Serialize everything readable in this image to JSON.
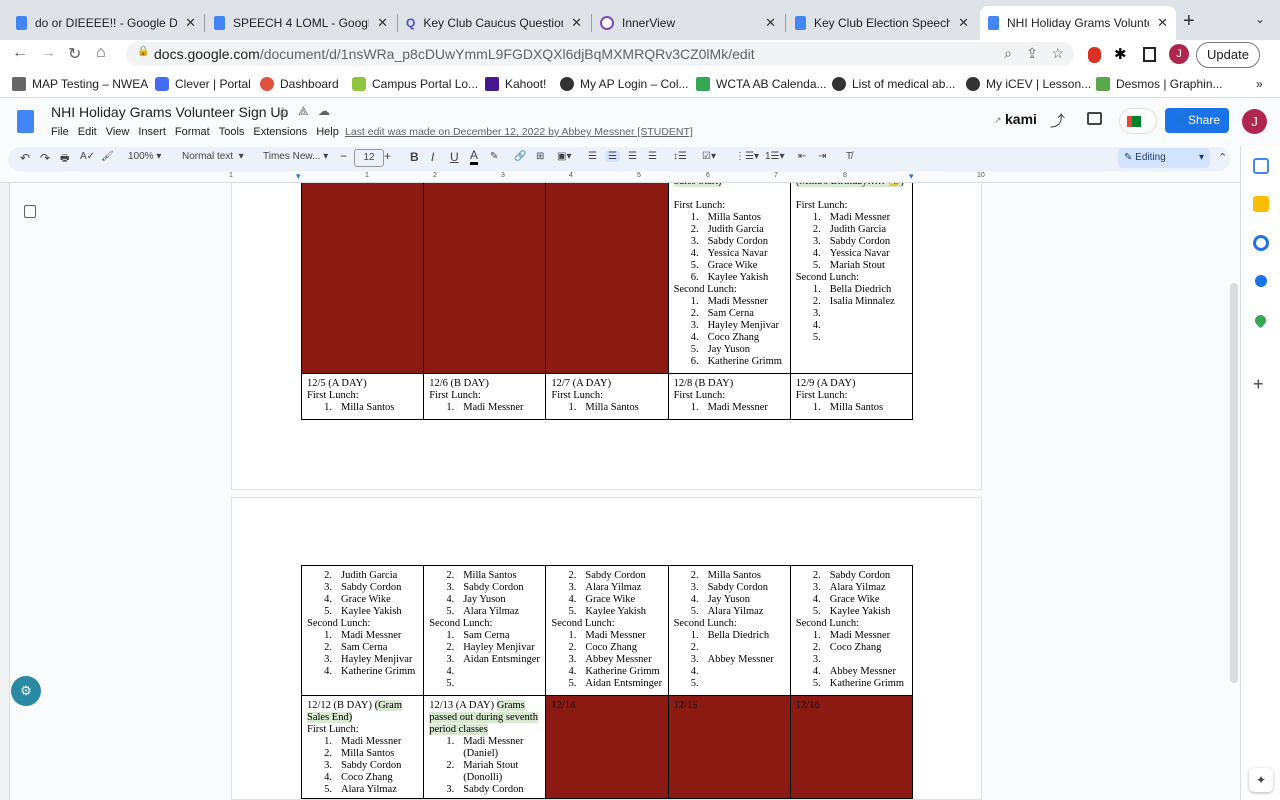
{
  "browser": {
    "tabs": [
      {
        "label": "do or DIEEEE!! - Google Do",
        "icon": "docs-icon"
      },
      {
        "label": "SPEECH 4 LOML - Google D",
        "icon": "docs-icon"
      },
      {
        "label": "Key Club Caucus Questions",
        "icon": "search-icon"
      },
      {
        "label": "InnerView",
        "icon": "innerview-icon"
      },
      {
        "label": "Key Club Election Speech -",
        "icon": "docs-icon"
      },
      {
        "label": "NHI Holiday Grams Voluntee",
        "icon": "docs-icon",
        "active": true
      }
    ],
    "new_tab": "+",
    "url_host": "docs.google.com",
    "url_path": "/document/d/1nsWRa_p8cDUwYmmL9FGDXQXl6djBqMXMRQRv3CZ0lMk/edit",
    "profile_initial": "J",
    "update_label": "Update",
    "bookmarks": [
      "MAP Testing – NWEA",
      "Clever | Portal",
      "Dashboard",
      "Campus Portal Lo...",
      "Kahoot!",
      "My AP Login – Col...",
      "WCTA AB Calenda...",
      "List of medical ab...",
      "My iCEV | Lesson...",
      "Desmos | Graphin..."
    ],
    "more_bookmarks": "»"
  },
  "doc": {
    "title": "NHI Holiday Grams Volunteer Sign Up",
    "menu": [
      "File",
      "Edit",
      "View",
      "Insert",
      "Format",
      "Tools",
      "Extensions",
      "Help"
    ],
    "last_edit": "Last edit was made on December 12, 2022 by Abbey Messner [STUDENT]",
    "kami": "kami",
    "share": "Share",
    "user_initial": "J",
    "toolbar": {
      "zoom": "100%",
      "style": "Normal text",
      "font": "Times New...",
      "size": "12",
      "mode": "Editing"
    },
    "ruler": [
      "1",
      "1",
      "2",
      "3",
      "4",
      "5",
      "6",
      "7",
      "8",
      "10"
    ]
  },
  "colors": {
    "red_cell": "#8b1a12",
    "highlight": "#d9ead3",
    "accent": "#1a73e8"
  },
  "table1": [
    [
      {
        "red": true,
        "lines": []
      },
      {
        "red": true,
        "lines": []
      },
      {
        "red": true,
        "lines": []
      },
      {
        "lines": [
          {
            "t": "Sales Start)",
            "hl": true
          },
          {
            "t": ""
          },
          {
            "t": "First Lunch:"
          },
          {
            "n": "1.",
            "t": "Milla Santos"
          },
          {
            "n": "2.",
            "t": "Judith Garcia"
          },
          {
            "n": "3.",
            "t": "Sabdy Cordon"
          },
          {
            "n": "4.",
            "t": "Yessica Navar"
          },
          {
            "n": "5.",
            "t": "Grace Wike"
          },
          {
            "n": "6.",
            "t": "Kaylee Yakish"
          },
          {
            "t": "Second Lunch:"
          },
          {
            "n": "1.",
            "t": "Madi Messner"
          },
          {
            "n": "2.",
            "t": "Sam Cerna"
          },
          {
            "n": "3.",
            "t": "Hayley Menjivar"
          },
          {
            "n": "4.",
            "t": "Coco Zhang"
          },
          {
            "n": "5.",
            "t": "Jay Yuson"
          },
          {
            "n": "6.",
            "t": "Katherine Grimm"
          }
        ]
      },
      {
        "lines": [
          {
            "t": "(Milla's Birthday!!!!! 🥳)",
            "hl": true
          },
          {
            "t": ""
          },
          {
            "t": "First Lunch:"
          },
          {
            "n": "1.",
            "t": "Madi Messner"
          },
          {
            "n": "2.",
            "t": "Judith Garcia"
          },
          {
            "n": "3.",
            "t": "Sabdy Cordon"
          },
          {
            "n": "4.",
            "t": "Yessica Navar"
          },
          {
            "n": "5.",
            "t": " Mariah Stout"
          },
          {
            "t": "Second Lunch:"
          },
          {
            "n": "1.",
            "t": "Bella Diedrich"
          },
          {
            "n": "2.",
            "t": "Isalia Minnalez"
          },
          {
            "n": "3.",
            "t": ""
          },
          {
            "n": "4.",
            "t": ""
          },
          {
            "n": "5.",
            "t": ""
          }
        ]
      }
    ],
    [
      {
        "lines": [
          {
            "t": "12/5 (A DAY)"
          },
          {
            "t": "First Lunch:"
          },
          {
            "n": "1.",
            "t": "Milla Santos"
          }
        ]
      },
      {
        "lines": [
          {
            "t": "12/6 (B DAY)"
          },
          {
            "t": "First Lunch:"
          },
          {
            "n": "1.",
            "t": "Madi Messner"
          }
        ]
      },
      {
        "lines": [
          {
            "t": "12/7 (A DAY)"
          },
          {
            "t": "First Lunch:"
          },
          {
            "n": "1.",
            "t": "Milla Santos"
          }
        ]
      },
      {
        "lines": [
          {
            "t": "12/8 (B DAY)"
          },
          {
            "t": "First Lunch:"
          },
          {
            "n": "1.",
            "t": "Madi Messner"
          }
        ]
      },
      {
        "lines": [
          {
            "t": "12/9 (A DAY)"
          },
          {
            "t": "First Lunch:"
          },
          {
            "n": "1.",
            "t": "Milla Santos"
          }
        ]
      }
    ]
  ],
  "table2": [
    [
      {
        "lines": [
          {
            "n": "2.",
            "t": "Judith Garcia"
          },
          {
            "n": "3.",
            "t": "Sabdy Cordon"
          },
          {
            "n": "4.",
            "t": " Grace Wike"
          },
          {
            "n": "5.",
            "t": "Kaylee Yakish"
          },
          {
            "t": "Second Lunch:"
          },
          {
            "n": "1.",
            "t": "Madi Messner"
          },
          {
            "n": "2.",
            "t": "Sam Cerna"
          },
          {
            "n": "3.",
            "t": "Hayley Menjivar"
          },
          {
            "n": "4.",
            "t": "Katherine Grimm"
          }
        ]
      },
      {
        "lines": [
          {
            "n": "2.",
            "t": "Milla Santos"
          },
          {
            "n": "3.",
            "t": "Sabdy Cordon"
          },
          {
            "n": "4.",
            "t": "Jay Yuson"
          },
          {
            "n": "5.",
            "t": "Alara Yilmaz"
          },
          {
            "t": "Second Lunch:"
          },
          {
            "n": "1.",
            "t": "Sam Cerna"
          },
          {
            "n": "2.",
            "t": "Hayley Menjivar"
          },
          {
            "n": "3.",
            "t": "Aidan Entsminger"
          },
          {
            "n": "4.",
            "t": ""
          },
          {
            "n": "5.",
            "t": ""
          }
        ]
      },
      {
        "lines": [
          {
            "n": "2.",
            "t": "Sabdy Cordon"
          },
          {
            "n": "3.",
            "t": "Alara Yilmaz"
          },
          {
            "n": "4.",
            "t": " Grace Wike"
          },
          {
            "n": "5.",
            "t": " Kaylee Yakish"
          },
          {
            "t": "Second Lunch:"
          },
          {
            "n": "1.",
            "t": "Madi Messner"
          },
          {
            "n": "2.",
            "t": "Coco Zhang"
          },
          {
            "n": "3.",
            "t": "Abbey Messner"
          },
          {
            "n": "4.",
            "t": "Katherine Grimm"
          },
          {
            "n": "5.",
            "t": "Aidan Entsminger"
          }
        ]
      },
      {
        "lines": [
          {
            "n": "2.",
            "t": "Milla Santos"
          },
          {
            "n": "3.",
            "t": "Sabdy Cordon"
          },
          {
            "n": "4.",
            "t": "Jay Yuson"
          },
          {
            "n": "5.",
            "t": "Alara Yilmaz"
          },
          {
            "t": "Second Lunch:"
          },
          {
            "n": "1.",
            "t": "Bella Diedrich"
          },
          {
            "n": "2.",
            "t": ""
          },
          {
            "n": "3.",
            "t": "Abbey Messner"
          },
          {
            "n": "4.",
            "t": ""
          },
          {
            "n": "5.",
            "t": ""
          }
        ]
      },
      {
        "lines": [
          {
            "n": "2.",
            "t": "Sabdy Cordon"
          },
          {
            "n": "3.",
            "t": "Alara Yilmaz"
          },
          {
            "n": "4.",
            "t": " Grace Wike"
          },
          {
            "n": "5.",
            "t": " Kaylee Yakish"
          },
          {
            "t": "Second Lunch:"
          },
          {
            "n": "1.",
            "t": "Madi Messner"
          },
          {
            "n": "2.",
            "t": "Coco Zhang"
          },
          {
            "n": "3.",
            "t": ""
          },
          {
            "n": "4.",
            "t": "Abbey Messner"
          },
          {
            "n": "5.",
            "t": "Katherine Grimm"
          }
        ]
      }
    ],
    [
      {
        "lines": [
          {
            "t": "12/12 (B DAY)  ",
            "hlt": "(Gram"
          },
          {
            "t": "Sales End)",
            "hl": true
          },
          {
            "t": "First Lunch:"
          },
          {
            "n": "1.",
            "t": "Madi Messner"
          },
          {
            "n": "2.",
            "t": "Milla Santos"
          },
          {
            "n": "3.",
            "t": "Sabdy Cordon"
          },
          {
            "n": "4.",
            "t": "Coco Zhang"
          },
          {
            "n": "5.",
            "t": "Alara Yilmaz"
          }
        ]
      },
      {
        "lines": [
          {
            "t": "12/13 (A DAY) ",
            "hlt": "Grams"
          },
          {
            "t": "passed out during seventh",
            "hl": true
          },
          {
            "t": "period classes",
            "hl": true
          },
          {
            "n": "1.",
            "t": "Madi Messner"
          },
          {
            "n": "",
            "t": "(Daniel)"
          },
          {
            "n": "2.",
            "t": "Mariah Stout"
          },
          {
            "n": "",
            "t": "(Donolli)"
          },
          {
            "n": "3.",
            "t": "Sabdy Cordon"
          }
        ]
      },
      {
        "red": true,
        "lines": [
          {
            "t": "12/14"
          }
        ]
      },
      {
        "red": true,
        "lines": [
          {
            "t": "12/15"
          }
        ]
      },
      {
        "red": true,
        "lines": [
          {
            "t": "12/16"
          }
        ]
      }
    ]
  ]
}
